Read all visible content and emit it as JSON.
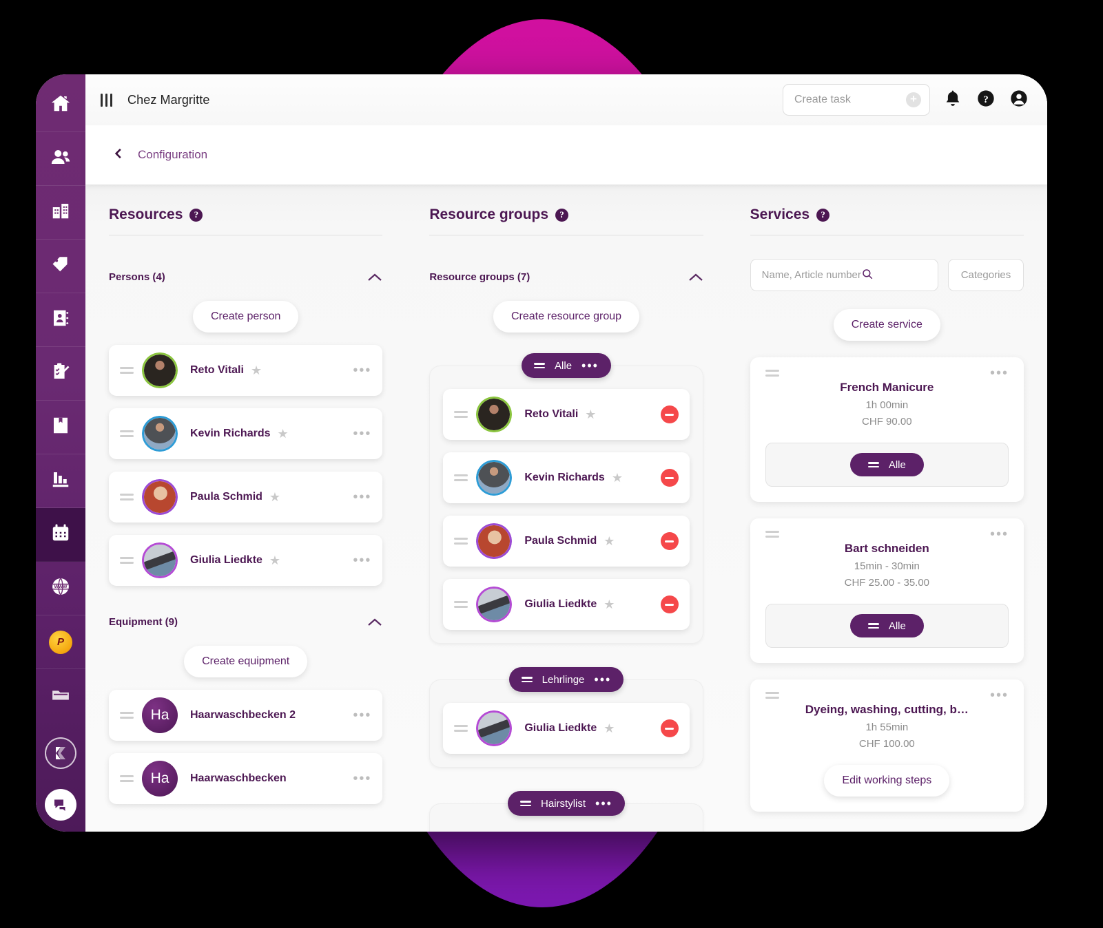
{
  "background": {
    "blob_top_color": "#d1109f",
    "blob_bottom_color": "#7b18b0",
    "page_color": "#000000"
  },
  "brand": {
    "purple": "#4c1752",
    "rail": "#5c2168",
    "accent_red": "#f5484a"
  },
  "topbar": {
    "menu_icon": "hamburger-icon",
    "app_title": "Chez Margritte",
    "create_task_placeholder": "Create task",
    "add_icon": "plus-circle-icon",
    "notifications_icon": "bell-icon",
    "help_icon": "question-circle-icon",
    "account_icon": "user-circle-icon"
  },
  "subbar": {
    "back_icon": "chevron-left-icon",
    "breadcrumb": "Configuration"
  },
  "sidebar": {
    "items": [
      {
        "icon": "home-icon",
        "active": false
      },
      {
        "icon": "people-icon",
        "active": false
      },
      {
        "icon": "building-icon",
        "active": false
      },
      {
        "icon": "tag-icon",
        "active": false
      },
      {
        "icon": "contact-book-icon",
        "active": false
      },
      {
        "icon": "clipboard-check-icon",
        "active": false
      },
      {
        "icon": "bookmark-book-icon",
        "active": false
      },
      {
        "icon": "bar-chart-icon",
        "active": false
      },
      {
        "icon": "calendar-icon",
        "active": true
      },
      {
        "icon": "www-globe-icon",
        "active": false
      },
      {
        "icon": "pos-badge-icon",
        "active": false,
        "badge_label": "P"
      },
      {
        "icon": "folder-icon",
        "active": false
      }
    ],
    "logo_icon": "k-logo-icon",
    "chat_icon": "chat-bubble-icon"
  },
  "columns": {
    "resources": {
      "title": "Resources",
      "help_icon": "question-circle-icon",
      "sections": [
        {
          "label": "Persons (4)",
          "collapse_icon": "chevron-up-icon",
          "create_label": "Create person",
          "items": [
            {
              "name": "Reto Vitali",
              "ring": "#8bc53f",
              "favorite_icon": "star-icon",
              "menu_icon": "more-horizontal-icon"
            },
            {
              "name": "Kevin Richards",
              "ring": "#2e9cd6",
              "favorite_icon": "star-icon",
              "menu_icon": "more-horizontal-icon"
            },
            {
              "name": "Paula Schmid",
              "ring": "#9b4bd4",
              "favorite_icon": "star-icon",
              "menu_icon": "more-horizontal-icon"
            },
            {
              "name": "Giulia Liedkte",
              "ring": "#b44bd4",
              "favorite_icon": "star-icon",
              "menu_icon": "more-horizontal-icon"
            }
          ]
        },
        {
          "label": "Equipment (9)",
          "collapse_icon": "chevron-up-icon",
          "create_label": "Create equipment",
          "items": [
            {
              "name": "Haarwaschbecken 2",
              "initials": "Ha",
              "menu_icon": "more-horizontal-icon"
            },
            {
              "name": "Haarwaschbecken",
              "initials": "Ha",
              "menu_icon": "more-horizontal-icon"
            }
          ]
        }
      ]
    },
    "resource_groups": {
      "title": "Resource groups",
      "help_icon": "question-circle-icon",
      "section_label": "Resource groups (7)",
      "collapse_icon": "chevron-up-icon",
      "create_label": "Create resource group",
      "groups": [
        {
          "name": "Alle",
          "grip_icon": "drag-handle-icon",
          "menu_icon": "more-horizontal-icon",
          "members": [
            {
              "name": "Reto Vitali",
              "ring": "#8bc53f",
              "favorite_icon": "star-icon",
              "remove_icon": "remove-circle-icon"
            },
            {
              "name": "Kevin Richards",
              "ring": "#2e9cd6",
              "favorite_icon": "star-icon",
              "remove_icon": "remove-circle-icon"
            },
            {
              "name": "Paula Schmid",
              "ring": "#9b4bd4",
              "favorite_icon": "star-icon",
              "remove_icon": "remove-circle-icon"
            },
            {
              "name": "Giulia Liedkte",
              "ring": "#b44bd4",
              "favorite_icon": "star-icon",
              "remove_icon": "remove-circle-icon"
            }
          ]
        },
        {
          "name": "Lehrlinge",
          "grip_icon": "drag-handle-icon",
          "menu_icon": "more-horizontal-icon",
          "members": [
            {
              "name": "Giulia Liedkte",
              "ring": "#b44bd4",
              "favorite_icon": "star-icon",
              "remove_icon": "remove-circle-icon"
            }
          ]
        },
        {
          "name": "Hairstylist",
          "grip_icon": "drag-handle-icon",
          "menu_icon": "more-horizontal-icon",
          "members": []
        }
      ]
    },
    "services": {
      "title": "Services",
      "help_icon": "question-circle-icon",
      "search_placeholder": "Name, Article number",
      "search_icon": "search-icon",
      "categories_label": "Categories",
      "create_label": "Create service",
      "items": [
        {
          "title": "French Manicure",
          "duration": "1h 00min",
          "price": "CHF 90.00",
          "grip_icon": "drag-handle-icon",
          "menu_icon": "more-horizontal-icon",
          "chip": "Alle",
          "action_label": ""
        },
        {
          "title": "Bart schneiden",
          "duration": "15min - 30min",
          "price": "CHF 25.00 - 35.00",
          "grip_icon": "drag-handle-icon",
          "menu_icon": "more-horizontal-icon",
          "chip": "Alle",
          "action_label": ""
        },
        {
          "title": "Dyeing, washing, cutting, b…",
          "duration": "1h 55min",
          "price": "CHF 100.00",
          "grip_icon": "drag-handle-icon",
          "menu_icon": "more-horizontal-icon",
          "chip": "",
          "action_label": "Edit working steps"
        }
      ]
    }
  }
}
